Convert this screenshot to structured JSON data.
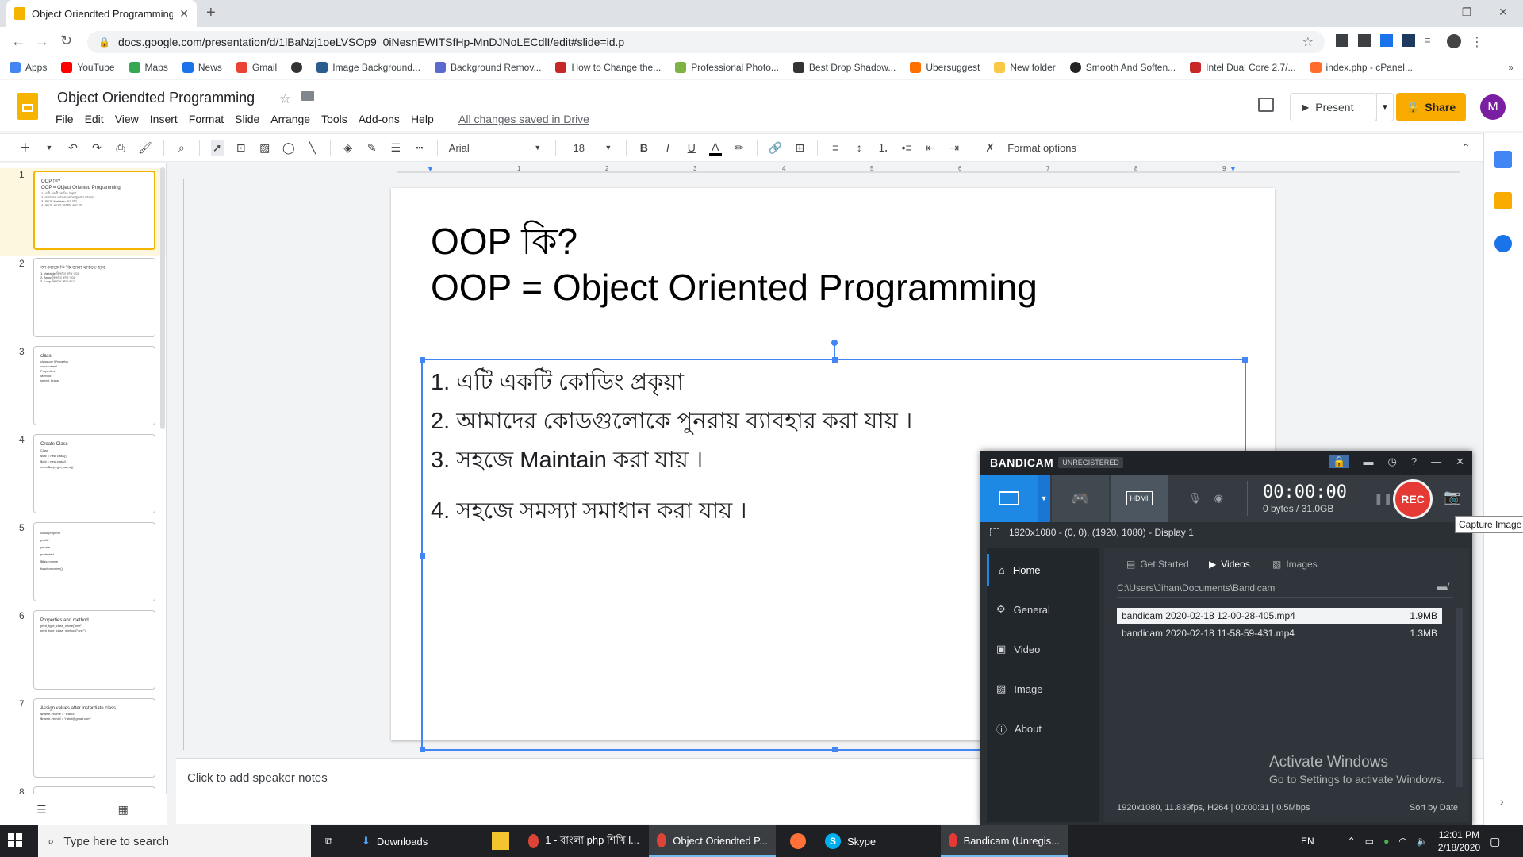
{
  "browser": {
    "tab_title": "Object Oriendted Programming",
    "url": "docs.google.com/presentation/d/1lBaNzj1oeLVSOp9_0iNesnEWITSfHp-MnDJNoLECdlI/edit#slide=id.p",
    "bookmarks": [
      {
        "label": "Apps",
        "color": "#4285f4"
      },
      {
        "label": "YouTube",
        "color": "#ff0000"
      },
      {
        "label": "Maps",
        "color": "#34a853"
      },
      {
        "label": "News",
        "color": "#1a73e8"
      },
      {
        "label": "Gmail",
        "color": "#ea4335"
      },
      {
        "label": "",
        "color": "#333333"
      },
      {
        "label": "Image Background...",
        "color": "#2a5d8f"
      },
      {
        "label": "Background Remov...",
        "color": "#5a6acf"
      },
      {
        "label": "How to Change the...",
        "color": "#c62828"
      },
      {
        "label": "Professional Photo...",
        "color": "#7cb342"
      },
      {
        "label": "Best Drop Shadow...",
        "color": "#333333"
      },
      {
        "label": "Ubersuggest",
        "color": "#ff6f00"
      },
      {
        "label": "New folder",
        "color": "#f9c846"
      },
      {
        "label": "Smooth And Soften...",
        "color": "#222222"
      },
      {
        "label": "Intel Dual Core 2.7/...",
        "color": "#c62828"
      },
      {
        "label": "index.php - cPanel...",
        "color": "#ff6c2c"
      }
    ]
  },
  "slides": {
    "doc_title": "Object Oriendted Programming",
    "menu": [
      "File",
      "Edit",
      "View",
      "Insert",
      "Format",
      "Slide",
      "Arrange",
      "Tools",
      "Add-ons",
      "Help"
    ],
    "saved_status": "All changes saved in Drive",
    "present_label": "Present",
    "share_label": "Share",
    "avatar_letter": "M",
    "toolbar": {
      "font": "Arial",
      "font_size": "18",
      "format_options": "Format options"
    },
    "ruler_numbers": [
      "1",
      "2",
      "3",
      "4",
      "5",
      "6",
      "7",
      "8",
      "9"
    ],
    "thumbnails": [
      {
        "num": "1",
        "lines": [
          "OOP কি?",
          "OOP = Object Oriented Programming",
          "1. এটি একটি কোডিং প্রকৃয়া",
          "2. আমাদের কোডগুলোকে পুনরায় ব্যাবহার",
          "3. সহজে Maintain করা যায়",
          "4. সহজে সমস্যা সমাধান করা যায়"
        ]
      },
      {
        "num": "2",
        "lines": [
          "আপনাকে কি কি জানা থাকতে হবে",
          "1. Variable কিভাবে কাজ করে",
          "2. Array কিভাবে কাজ করে",
          "3. Loop কিভাবে কাজ করে"
        ]
      },
      {
        "num": "3",
        "lines": [
          "class",
          "class car (Property)",
          "color, wheel",
          "Properties",
          "Method",
          "speed, brake"
        ]
      },
      {
        "num": "4",
        "lines": [
          "Create Class",
          "Class",
          "$var = new class()",
          "$obj = new class()",
          "echo $obj->get_name()"
        ]
      },
      {
        "num": "5",
        "lines": [
          "class property",
          "public",
          "private",
          "protected",
          "$this->name",
          "function name()"
        ]
      },
      {
        "num": "6",
        "lines": [
          "Properties and method",
          "print_type_class_name(\"one\")",
          "print_type_class_method(\"one\")"
        ]
      },
      {
        "num": "7",
        "lines": [
          "Assign values after instantiate class",
          "$name->name = \"Rahul\"",
          "$name->email = \"rahul@gmail.com\""
        ]
      },
      {
        "num": "8",
        "lines": []
      }
    ],
    "slide": {
      "title_line1": "OOP কি?",
      "title_line2": "OOP = Object Oriented Programming",
      "body": [
        "1. এটি একটি কোডিং প্রকৃয়া",
        "2. আমাদের কোডগুলোকে পুনরায় ব্যাবহার করা যায় ।",
        "3. সহজে Maintain করা যায় ।",
        "4. সহজে সমস্যা সমাধান করা যায় ।"
      ]
    },
    "speaker_notes_placeholder": "Click to add speaker notes"
  },
  "bandicam": {
    "logo": "BANDICAM",
    "badge": "UNREGISTERED",
    "timer": "00:00:00",
    "bytes": "0 bytes / 31.0GB",
    "rec_label": "REC",
    "capture_tooltip": "Capture Image",
    "resolution": "1920x1080 - (0, 0), (1920, 1080) - Display 1",
    "nav": [
      "Home",
      "General",
      "Video",
      "Image",
      "About"
    ],
    "tabs": [
      "Get Started",
      "Videos",
      "Images"
    ],
    "path": "C:\\Users\\Jihan\\Documents\\Bandicam",
    "files": [
      {
        "name": "bandicam 2020-02-18 12-00-28-405.mp4",
        "size": "1.9MB"
      },
      {
        "name": "bandicam 2020-02-18 11-58-59-431.mp4",
        "size": "1.3MB"
      }
    ],
    "footer_info": "1920x1080, 11.839fps, H264 | 00:00:31 | 0.5Mbps",
    "sort_label": "Sort by Date"
  },
  "watermark": {
    "line1": "Activate Windows",
    "line2": "Go to Settings to activate Windows."
  },
  "taskbar": {
    "search_placeholder": "Type here to search",
    "tasks": [
      "Downloads",
      "",
      "1 - বাংলা php শিখি l...",
      "Object Oriendted P...",
      "",
      "Skype",
      "Bandicam (Unregis..."
    ],
    "lang": "EN",
    "time": "12:01 PM",
    "date": "2/18/2020"
  }
}
